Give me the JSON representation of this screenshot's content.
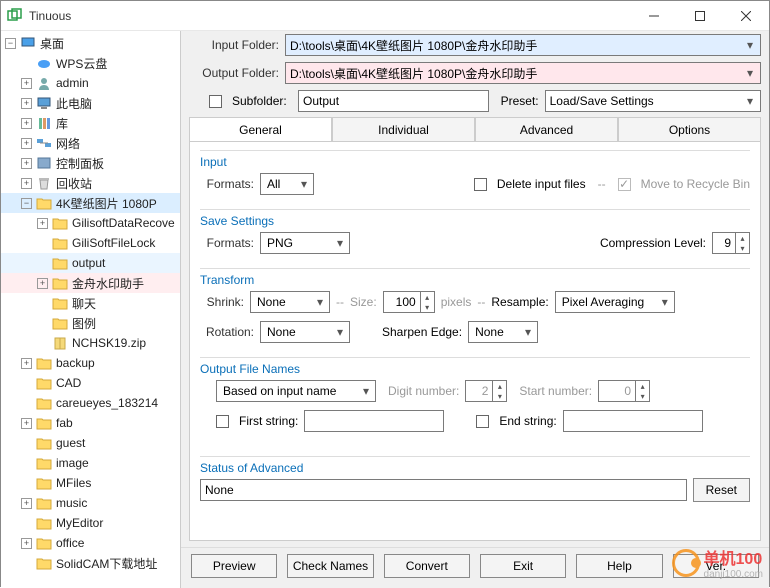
{
  "window": {
    "title": "Tinuous"
  },
  "tree": {
    "root": "桌面",
    "items": [
      {
        "label": "WPS云盘",
        "icon": "cloud",
        "ind": 2,
        "exp": "none"
      },
      {
        "label": "admin",
        "icon": "user",
        "ind": 2,
        "exp": "plus"
      },
      {
        "label": "此电脑",
        "icon": "pc",
        "ind": 2,
        "exp": "plus"
      },
      {
        "label": "库",
        "icon": "lib",
        "ind": 2,
        "exp": "plus"
      },
      {
        "label": "网络",
        "icon": "net",
        "ind": 2,
        "exp": "plus"
      },
      {
        "label": "控制面板",
        "icon": "ctrl",
        "ind": 2,
        "exp": "plus"
      },
      {
        "label": "回收站",
        "icon": "bin",
        "ind": 2,
        "exp": "plus"
      },
      {
        "label": "4K壁纸图片 1080P",
        "icon": "folder",
        "ind": 2,
        "exp": "minus",
        "cls": "sel"
      },
      {
        "label": "GilisoftDataRecove",
        "icon": "folder",
        "ind": 3,
        "exp": "plus"
      },
      {
        "label": "GiliSoftFileLock",
        "icon": "folder",
        "ind": 3,
        "exp": "none"
      },
      {
        "label": "output",
        "icon": "folder",
        "ind": 3,
        "exp": "none",
        "cls": "hl1"
      },
      {
        "label": "金舟水印助手",
        "icon": "folder",
        "ind": 3,
        "exp": "plus",
        "cls": "hl2"
      },
      {
        "label": "聊天",
        "icon": "folder",
        "ind": 3,
        "exp": "none"
      },
      {
        "label": "图例",
        "icon": "folder",
        "ind": 3,
        "exp": "none"
      },
      {
        "label": "NCHSK19.zip",
        "icon": "zip",
        "ind": 3,
        "exp": "none"
      },
      {
        "label": "backup",
        "icon": "folder",
        "ind": 2,
        "exp": "plus"
      },
      {
        "label": "CAD",
        "icon": "folder",
        "ind": 2,
        "exp": "none"
      },
      {
        "label": "careueyes_183214",
        "icon": "folder",
        "ind": 2,
        "exp": "none"
      },
      {
        "label": "fab",
        "icon": "folder",
        "ind": 2,
        "exp": "plus"
      },
      {
        "label": "guest",
        "icon": "folder",
        "ind": 2,
        "exp": "none"
      },
      {
        "label": "image",
        "icon": "folder",
        "ind": 2,
        "exp": "none"
      },
      {
        "label": "MFiles",
        "icon": "folder",
        "ind": 2,
        "exp": "none"
      },
      {
        "label": "music",
        "icon": "folder",
        "ind": 2,
        "exp": "plus"
      },
      {
        "label": "MyEditor",
        "icon": "folder",
        "ind": 2,
        "exp": "none"
      },
      {
        "label": "office",
        "icon": "folder",
        "ind": 2,
        "exp": "plus"
      },
      {
        "label": "SolidCAM下载地址",
        "icon": "folder",
        "ind": 2,
        "exp": "none"
      }
    ]
  },
  "form": {
    "input_folder_label": "Input Folder:",
    "input_folder_value": "D:\\tools\\桌面\\4K壁纸图片 1080P\\金舟水印助手",
    "output_folder_label": "Output Folder:",
    "output_folder_value": "D:\\tools\\桌面\\4K壁纸图片 1080P\\金舟水印助手",
    "subfolder_label": "Subfolder:",
    "subfolder_value": "Output",
    "preset_label": "Preset:",
    "preset_value": "Load/Save Settings"
  },
  "tabs": {
    "general": "General",
    "individual": "Individual",
    "advanced": "Advanced",
    "options": "Options"
  },
  "input": {
    "title": "Input",
    "formats_label": "Formats:",
    "formats_value": "All",
    "delete_label": "Delete input files",
    "recycle_label": "Move to Recycle Bin"
  },
  "save": {
    "title": "Save Settings",
    "formats_label": "Formats:",
    "formats_value": "PNG",
    "compression_label": "Compression Level:",
    "compression_value": "9"
  },
  "transform": {
    "title": "Transform",
    "shrink_label": "Shrink:",
    "shrink_value": "None",
    "size_label": "Size:",
    "size_value": "100",
    "size_unit": "pixels",
    "resample_label": "Resample:",
    "resample_value": "Pixel Averaging",
    "rotation_label": "Rotation:",
    "rotation_value": "None",
    "sharpen_label": "Sharpen Edge:",
    "sharpen_value": "None",
    "sep": "--"
  },
  "output": {
    "title": "Output File Names",
    "based_on": "Based on input name",
    "digit_label": "Digit number:",
    "digit_value": "2",
    "start_label": "Start number:",
    "start_value": "0",
    "first_string": "First string:",
    "end_string": "End string:"
  },
  "status": {
    "title": "Status of Advanced",
    "value": "None",
    "reset": "Reset"
  },
  "buttons": {
    "preview": "Preview",
    "check": "Check Names",
    "convert": "Convert",
    "exit": "Exit",
    "help": "Help",
    "ver": "Ver."
  },
  "watermark": {
    "t1": "单机100",
    "t2": "danji100.com"
  }
}
